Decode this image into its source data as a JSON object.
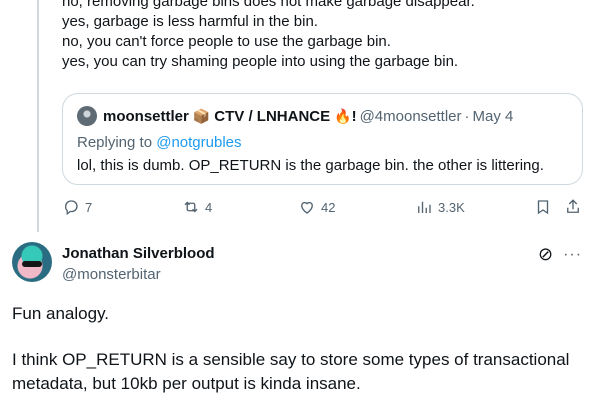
{
  "top_tweet": {
    "lines": [
      "no, removing garbage bins does not make garbage disappear.",
      "yes, garbage is less harmful in the bin.",
      "no, you can't force people to use the garbage bin.",
      "yes, you can try shaming people into using the garbage bin."
    ],
    "quote": {
      "name": "moonsettler",
      "badge1": "📦",
      "name_part2": "CTV / LNHANCE",
      "badge2": "🔥",
      "bang": "!",
      "handle": "@4moonsettler",
      "sep": "·",
      "date": "May 4",
      "replying_prefix": "Replying to ",
      "replying_to": "@notgrubles",
      "text": "lol, this is dumb. OP_RETURN is the garbage bin. the other is littering."
    },
    "actions": {
      "replies": "7",
      "reposts": "4",
      "likes": "42",
      "views": "3.3K"
    }
  },
  "reply_post": {
    "author": "Jonathan Silverblood",
    "handle": "@monsterbitar",
    "text_p1": "Fun analogy.",
    "text_p2_line1": "I think OP_RETURN is a sensible say to store some types of transactional",
    "text_p2_line2": "metadata, but 10kb per output is kinda insane."
  }
}
